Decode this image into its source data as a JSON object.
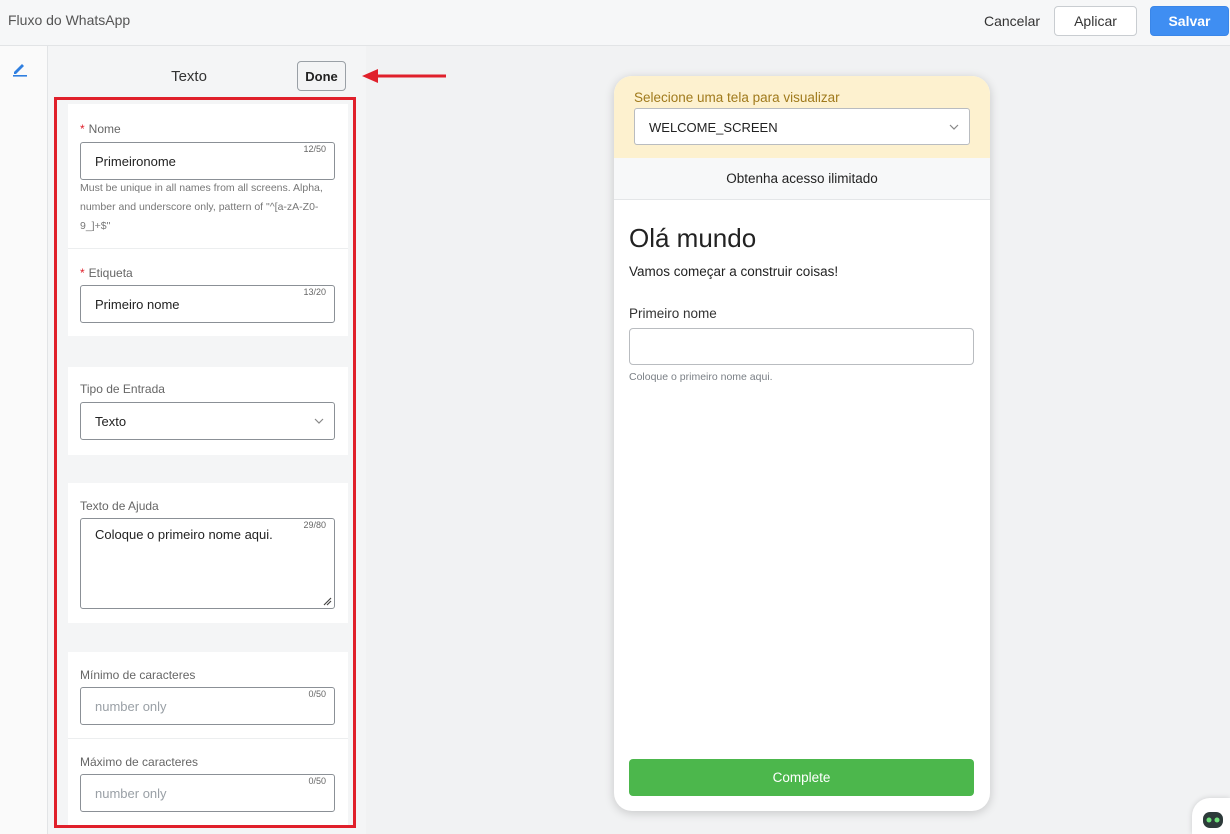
{
  "app": {
    "title": "Fluxo do WhatsApp"
  },
  "toolbar": {
    "cancel_label": "Cancelar",
    "apply_label": "Aplicar",
    "save_label": "Salvar"
  },
  "editor": {
    "title": "Texto",
    "done_label": "Done",
    "name_field": {
      "label": "Nome",
      "value": "Primeironome",
      "counter": "12/50",
      "help": "Must be unique in all names from all screens. Alpha, number and underscore only, pattern of \"^[a-zA-Z0-9_]+$\""
    },
    "label_field": {
      "label": "Etiqueta",
      "value": "Primeiro nome",
      "counter": "13/20"
    },
    "input_type": {
      "label": "Tipo de Entrada",
      "value": "Texto"
    },
    "helper_text": {
      "label": "Texto de Ajuda",
      "value": "Coloque o primeiro nome aqui.",
      "counter": "29/80"
    },
    "min_chars": {
      "label": "Mínimo de caracteres",
      "placeholder": "number only",
      "counter": "0/50"
    },
    "max_chars": {
      "label": "Máximo de caracteres",
      "placeholder": "number only",
      "counter": "0/50"
    }
  },
  "preview": {
    "selector_label": "Selecione uma tela para visualizar",
    "selected_screen": "WELCOME_SCREEN",
    "header": "Obtenha acesso ilimitado",
    "heading": "Olá mundo",
    "subheading": "Vamos começar a construir coisas!",
    "input_label": "Primeiro nome",
    "input_help": "Coloque o primeiro nome aqui.",
    "complete_label": "Complete"
  },
  "colors": {
    "primary": "#3f8ef2",
    "highlight": "#e0202b",
    "complete": "#4cb74c",
    "selector_bg": "#fdf1cf"
  }
}
